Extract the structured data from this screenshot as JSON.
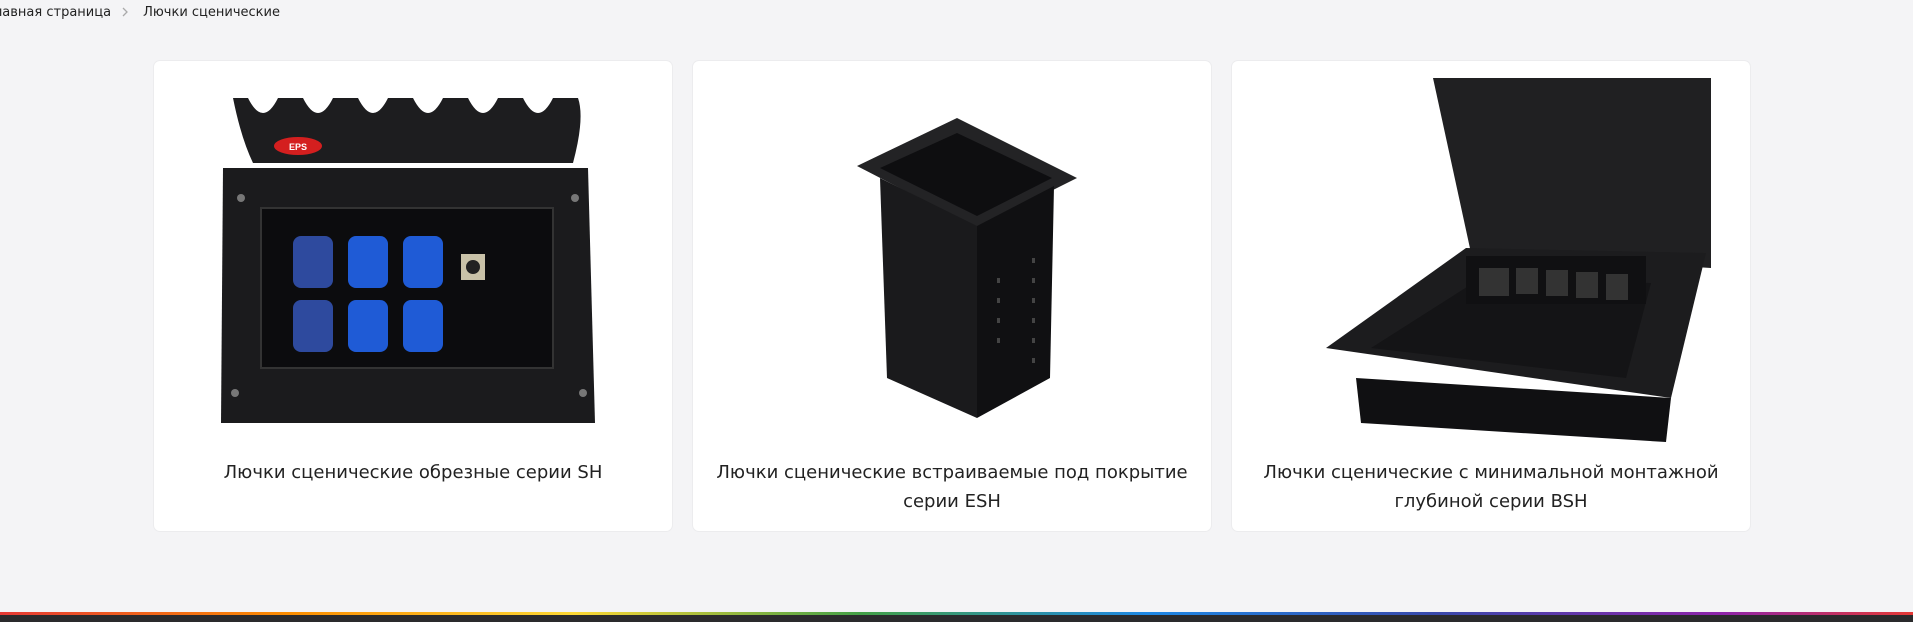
{
  "breadcrumb": {
    "home": "лавная страница",
    "current": "Лючки сценические"
  },
  "cards": [
    {
      "title": "Лючки сценические обрезные серии SH"
    },
    {
      "title": "Лючки сценические встраиваемые под покрытие серии ESH"
    },
    {
      "title": "Лючки сценические с минимальной монтажной глубиной серии BSH"
    }
  ],
  "colors": {
    "background": "#f4f4f6",
    "card": "#ffffff",
    "socket_blue": "#1f5bd6",
    "metal": "#1c1c1e"
  }
}
